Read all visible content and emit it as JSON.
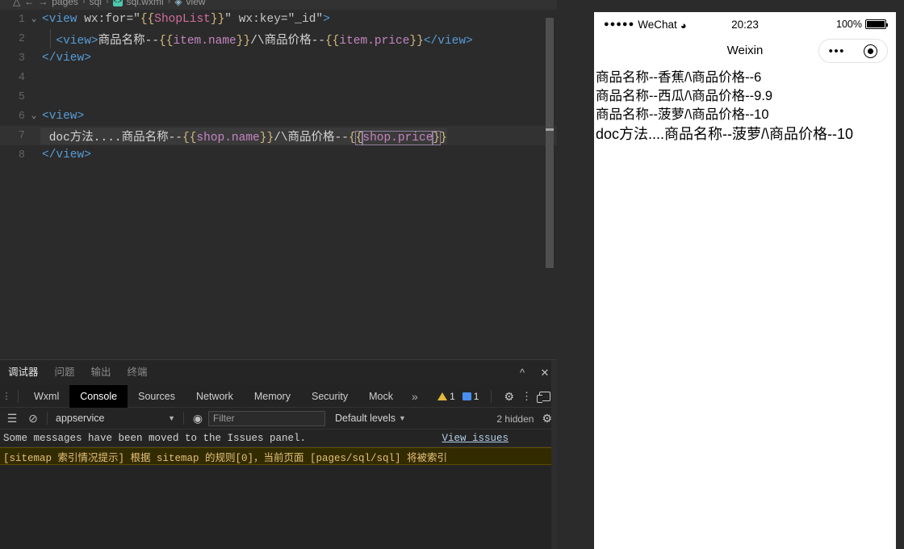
{
  "breadcrumb": {
    "items": [
      "pages",
      "sql",
      "sql.wxml",
      "view"
    ],
    "separator": "›",
    "wxml_icon": "wxml-file-icon",
    "view_icon": "view-tag-icon"
  },
  "editor": {
    "language": "wxml",
    "lines": [
      {
        "num": "1",
        "fold": "⌄",
        "indent": 0,
        "highlight": false,
        "tokens": [
          {
            "t": "<view ",
            "c": "tag"
          },
          {
            "t": "wx:for",
            "c": "attr"
          },
          {
            "t": "=",
            "c": "punc"
          },
          {
            "t": "\"",
            "c": "quote"
          },
          {
            "t": "{{",
            "c": "brace"
          },
          {
            "t": "ShopList",
            "c": "expr"
          },
          {
            "t": "}}",
            "c": "brace"
          },
          {
            "t": "\"",
            "c": "quote"
          },
          {
            "t": " ",
            "c": "plain"
          },
          {
            "t": "wx:key",
            "c": "attr"
          },
          {
            "t": "=",
            "c": "punc"
          },
          {
            "t": "\"_id\"",
            "c": "quote"
          },
          {
            "t": ">",
            "c": "tag"
          }
        ]
      },
      {
        "num": "2",
        "fold": "",
        "indent": 1,
        "highlight": false,
        "tokens": [
          {
            "t": "  ",
            "c": "plain"
          },
          {
            "t": "<view>",
            "c": "tag"
          },
          {
            "t": "商品名称--",
            "c": "text"
          },
          {
            "t": "{{",
            "c": "brace"
          },
          {
            "t": "item.name",
            "c": "expr2"
          },
          {
            "t": "}}",
            "c": "brace"
          },
          {
            "t": "/\\商品价格--",
            "c": "text"
          },
          {
            "t": "{{",
            "c": "brace"
          },
          {
            "t": "item.price",
            "c": "expr2"
          },
          {
            "t": "}}",
            "c": "brace"
          },
          {
            "t": "</view>",
            "c": "tag"
          }
        ]
      },
      {
        "num": "3",
        "fold": "",
        "indent": 0,
        "highlight": false,
        "tokens": [
          {
            "t": "</view>",
            "c": "tag"
          }
        ]
      },
      {
        "num": "4",
        "fold": "",
        "indent": 0,
        "highlight": false,
        "tokens": []
      },
      {
        "num": "5",
        "fold": "",
        "indent": 0,
        "highlight": false,
        "tokens": []
      },
      {
        "num": "6",
        "fold": "⌄",
        "indent": 0,
        "highlight": false,
        "tokens": [
          {
            "t": "<view>",
            "c": "tag"
          }
        ]
      },
      {
        "num": "7",
        "fold": "",
        "indent": 1,
        "highlight": true,
        "tokens": [
          {
            "t": " doc方法....商品名称--",
            "c": "text"
          },
          {
            "t": "{{",
            "c": "brace"
          },
          {
            "t": "shop.name",
            "c": "expr2"
          },
          {
            "t": "}}",
            "c": "brace"
          },
          {
            "t": "/\\商品价格--",
            "c": "text"
          },
          {
            "t": "{",
            "c": "brace"
          },
          {
            "t": "{",
            "c": "brace",
            "box": true
          },
          {
            "t": "shop.price",
            "c": "expr2",
            "box": true
          },
          {
            "t": "}",
            "c": "brace",
            "box": true
          },
          {
            "t": "}",
            "c": "brace"
          }
        ]
      },
      {
        "num": "8",
        "fold": "",
        "indent": 0,
        "highlight": false,
        "tokens": [
          {
            "t": "</view>",
            "c": "tag"
          }
        ]
      }
    ]
  },
  "panel": {
    "tabs": [
      {
        "label": "调试器",
        "active": true
      },
      {
        "label": "问题",
        "active": false
      },
      {
        "label": "输出",
        "active": false
      },
      {
        "label": "终端",
        "active": false
      }
    ],
    "collapse_icon": "chevron-up-icon",
    "close_icon": "close-icon"
  },
  "devtools": {
    "tabs": [
      {
        "label": "Wxml",
        "active": false
      },
      {
        "label": "Console",
        "active": true
      },
      {
        "label": "Sources",
        "active": false
      },
      {
        "label": "Network",
        "active": false
      },
      {
        "label": "Memory",
        "active": false
      },
      {
        "label": "Security",
        "active": false
      },
      {
        "label": "Mock",
        "active": false
      }
    ],
    "overflow_label": "»",
    "warning_count": "1",
    "message_count": "1",
    "settings_icon": "gear-icon",
    "more_icon": "kebab-menu-icon",
    "dock_icon": "dock-side-icon"
  },
  "console": {
    "clear_icon": "clear-console-icon",
    "context": "appservice",
    "eye_icon": "live-expression-icon",
    "filter_placeholder": "Filter",
    "filter_value": "",
    "levels": "Default levels",
    "hidden_count": "2 hidden",
    "settings_icon": "console-settings-icon",
    "messages": [
      {
        "type": "info",
        "text": "Some messages have been moved to the Issues panel.",
        "link": "View issues"
      },
      {
        "type": "warning",
        "text": "[sitemap 索引情况提示] 根据 sitemap 的规则[0]，当前页面 [pages/sql/sql] 将被索引"
      }
    ]
  },
  "simulator": {
    "status": {
      "carrier": "WeChat",
      "signal_dots": "●●●●●",
      "wifi_icon": "wifi-icon",
      "time": "20:23",
      "battery_percent": "100%",
      "battery_icon": "battery-full-icon"
    },
    "nav": {
      "title": "Weixin",
      "capsule_more_icon": "more-dots-icon",
      "capsule_close_icon": "close-target-icon"
    },
    "page_lines": [
      {
        "text": "商品名称--香蕉/\\商品价格--6",
        "big": false
      },
      {
        "text": "商品名称--西瓜/\\商品价格--9.9",
        "big": false
      },
      {
        "text": "商品名称--菠萝/\\商品价格--10",
        "big": false
      },
      {
        "text": "doc方法....商品名称--菠萝/\\商品价格--10",
        "big": true
      }
    ]
  },
  "colors": {
    "editor_bg": "#2b2b2b",
    "panel_bg": "#242424",
    "accent_warning": "#e2b93d",
    "accent_message": "#4a8ef0",
    "tag_blue": "#569cd6",
    "brace_yellow": "#d7ba7d",
    "expr_pink": "#d16d9e",
    "expr_purple": "#c586c0"
  }
}
